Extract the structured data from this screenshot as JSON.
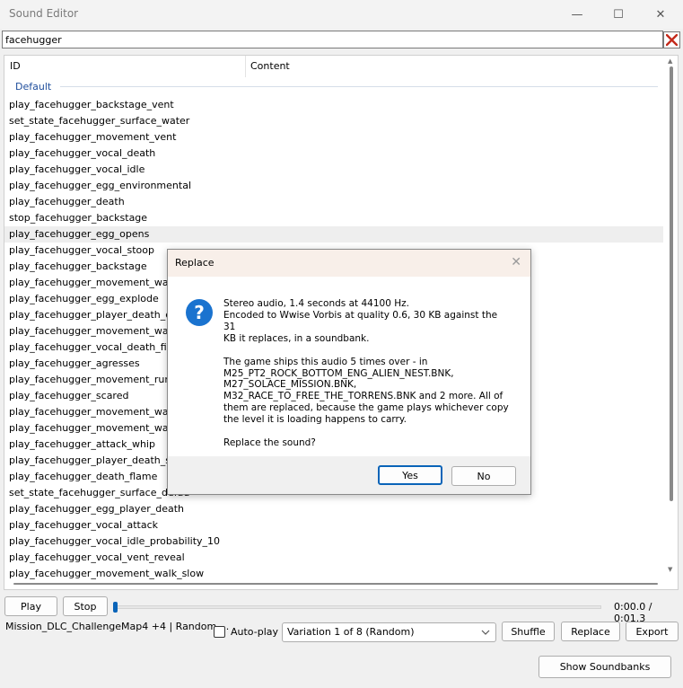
{
  "window": {
    "title": "Sound Editor",
    "minimize_glyph": "—",
    "maximize_glyph": "☐",
    "close_glyph": "✕"
  },
  "search": {
    "value": "facehugger"
  },
  "list": {
    "columns": [
      "ID",
      "Content"
    ],
    "group": "Default",
    "selected_index": 8,
    "rows": [
      "play_facehugger_backstage_vent",
      "set_state_facehugger_surface_water",
      "play_facehugger_movement_vent",
      "play_facehugger_vocal_death",
      "play_facehugger_vocal_idle",
      "play_facehugger_egg_environmental",
      "play_facehugger_death",
      "stop_facehugger_backstage",
      "play_facehugger_egg_opens",
      "play_facehugger_vocal_stoop",
      "play_facehugger_backstage",
      "play_facehugger_movement_walk_st",
      "play_facehugger_egg_explode",
      "play_facehugger_player_death_crouc",
      "play_facehugger_movement_walk_v",
      "play_facehugger_vocal_death_fire",
      "play_facehugger_agresses",
      "play_facehugger_movement_run",
      "play_facehugger_scared",
      "play_facehugger_movement_walk",
      "play_facehugger_movement_walk_sl",
      "play_facehugger_attack_whip",
      "play_facehugger_player_death_stand",
      "play_facehugger_death_flame",
      "set_state_facehugger_surface_defau",
      "play_facehugger_egg_player_death",
      "play_facehugger_vocal_attack",
      "play_facehugger_vocal_idle_probability_10",
      "play_facehugger_vocal_vent_reveal",
      "play_facehugger_movement_walk_slow"
    ]
  },
  "player": {
    "play_label": "Play",
    "stop_label": "Stop",
    "progress": 0.0,
    "time": "0:00.0 / 0:01.3"
  },
  "footer": {
    "mission": "Mission_DLC_ChallengeMap4 +4  |  Random ...",
    "autoplay_label": "Auto-play",
    "autoplay_checked": false,
    "variation": "Variation 1 of 8  (Random)",
    "shuffle_label": "Shuffle",
    "replace_label": "Replace",
    "export_label": "Export",
    "show_soundbanks_label": "Show Soundbanks"
  },
  "dialog": {
    "title": "Replace",
    "icon_glyph": "?",
    "lines_p1": [
      "Stereo audio, 1.4 seconds at 44100 Hz.",
      "Encoded to Wwise Vorbis at quality 0.6, 30 KB against the 31",
      "KB it replaces, in a soundbank."
    ],
    "lines_p2": [
      "The game ships this audio 5 times over - in",
      "M25_PT2_ROCK_BOTTOM_ENG_ALIEN_NEST.BNK,",
      "M27_SOLACE_MISSION.BNK,",
      "M32_RACE_TO_FREE_THE_TORRENS.BNK and 2 more. All of",
      "them are replaced, because the game plays whichever copy",
      "the level it is loading happens to carry."
    ],
    "question": "Replace the sound?",
    "yes_label": "Yes",
    "no_label": "No"
  },
  "colors": {
    "accent": "#0a64b8",
    "group_label": "#1f4e9c",
    "dialog_titlebar": "#f8efe9",
    "clear_icon": "#c42b1c"
  }
}
